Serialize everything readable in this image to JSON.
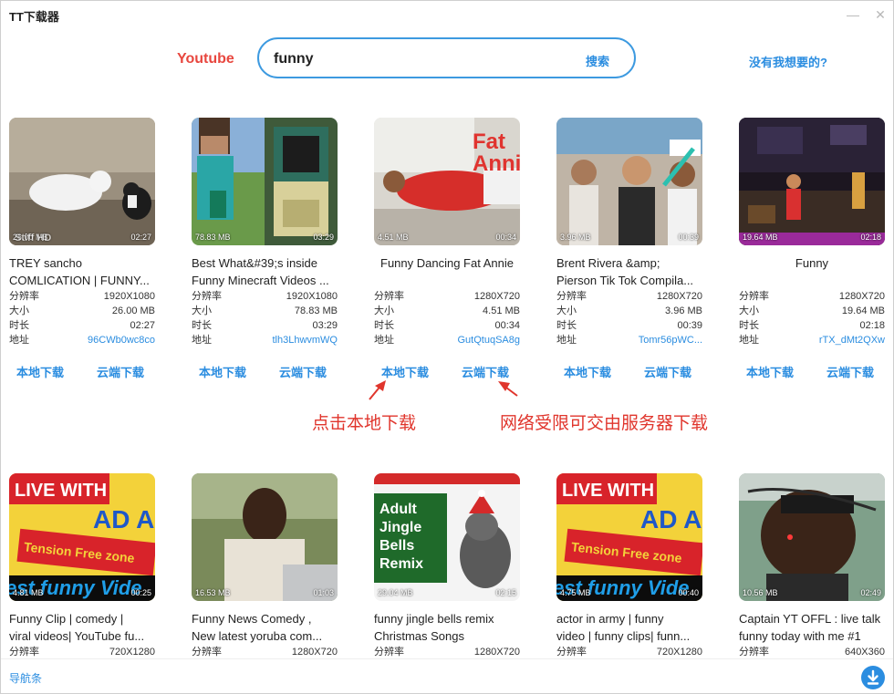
{
  "window": {
    "title": "TT下载器",
    "minimize_glyph": "—",
    "close_glyph": "✕"
  },
  "header": {
    "brand": "Youtube",
    "search_value": "funny",
    "search_button": "搜索",
    "missing_link": "没有我想要的?"
  },
  "labels": {
    "resolution": "分辨率",
    "size": "大小",
    "duration": "时长",
    "address": "地址",
    "local_download": "本地下载",
    "cloud_download": "云端下载"
  },
  "annotations": {
    "local_hint": "点击本地下载",
    "cloud_hint": "网络受限可交由服务器下载"
  },
  "videos": [
    {
      "title_line1": "TREY sancho",
      "title_line2": "COMLICATION | FUNNY...",
      "thumb_caption": "Stiff HD",
      "resolution": "1920X1080",
      "size": "26.00 MB",
      "duration": "02:27",
      "address": "96CWb0wc8co"
    },
    {
      "title_line1": "Best What&#39;s inside",
      "title_line2": "Funny Minecraft Videos ...",
      "resolution": "1920X1080",
      "size": "78.83 MB",
      "duration": "03:29",
      "address": "tlh3LhwvmWQ"
    },
    {
      "title_line1": "Funny Dancing Fat Annie",
      "title_line2": "",
      "thumb_caption": "Fat Annie",
      "resolution": "1280X720",
      "size": "4.51 MB",
      "duration": "00:34",
      "address": "GutQtuqSA8g"
    },
    {
      "title_line1": "Brent Rivera &amp;",
      "title_line2": "Pierson Tik Tok Compila...",
      "resolution": "1280X720",
      "size": "3.96 MB",
      "duration": "00:39",
      "address": "Tomr56pWC..."
    },
    {
      "title_line1": "Funny",
      "title_line2": "",
      "resolution": "1280X720",
      "size": "19.64 MB",
      "duration": "02:18",
      "address": "rTX_dMt2QXw"
    },
    {
      "title_line1": "Funny Clip | comedy |",
      "title_line2": "viral videos| YouTube fu...",
      "thumb_caption_top": "LIVE WITH",
      "thumb_caption_mid": "AD AA",
      "thumb_caption_banner": "Tension Free zone",
      "thumb_caption_bottom": "est funny Vide",
      "resolution": "720X1280",
      "size": "4.81 MB",
      "duration": "00:25"
    },
    {
      "title_line1": "Funny News Comedy ,",
      "title_line2": "New latest yoruba com...",
      "resolution": "1280X720",
      "size": "16.53 MB",
      "duration": "01:03"
    },
    {
      "title_line1": "funny jingle bells remix",
      "title_line2": "Christmas Songs",
      "thumb_caption": "Adult Jingle Bells Remix",
      "resolution": "1280X720",
      "size": "29.04 MB",
      "duration": "02:15"
    },
    {
      "title_line1": "actor in army | funny",
      "title_line2": "video | funny clips| funn...",
      "thumb_caption_top": "LIVE WITH",
      "thumb_caption_mid": "AD AA",
      "thumb_caption_banner": "Tension Free zone",
      "thumb_caption_bottom": "est funny Vide",
      "resolution": "720X1280",
      "size": "4.75 MB",
      "duration": "00:40"
    },
    {
      "title_line1": "Captain YT OFFL : live talk",
      "title_line2": "funny today with me #1",
      "resolution": "640X360",
      "size": "10.56 MB",
      "duration": "02:49"
    }
  ],
  "footer": {
    "nav": "导航条"
  },
  "colors": {
    "brand": "#e8473f",
    "accent": "#2b8de0",
    "annotation": "#e0352c"
  },
  "icons": [
    "minimize-icon",
    "close-icon",
    "download-icon",
    "arrow-up-icon"
  ]
}
